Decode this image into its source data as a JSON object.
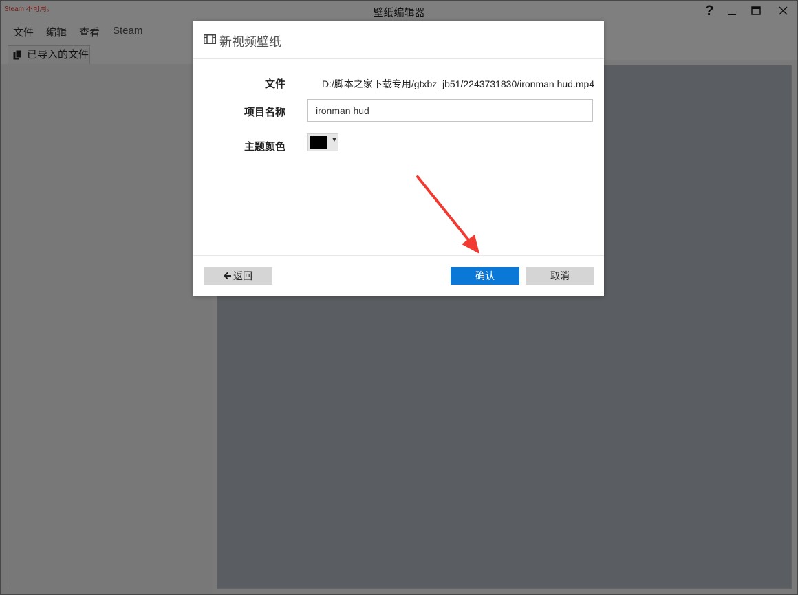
{
  "window": {
    "title": "壁纸编辑器",
    "warning": "Steam 不可用。",
    "help_label": "?",
    "minimize_label": "‒",
    "maximize_label": "□",
    "close_label": "✕"
  },
  "menu": {
    "items": [
      {
        "label": "文件"
      },
      {
        "label": "编辑"
      },
      {
        "label": "查看"
      },
      {
        "label": "Steam"
      }
    ]
  },
  "sidebar": {
    "tab_label": "已导入的文件"
  },
  "dialog": {
    "title": "新视频壁纸",
    "file_label": "文件",
    "file_path": "D:/脚本之家下载专用/gtxbz_jb51/2243731830/ironman hud.mp4",
    "name_label": "项目名称",
    "name_value": "ironman hud",
    "color_label": "主题颜色",
    "color_value": "#000000",
    "back_label": "返回",
    "ok_label": "确认",
    "cancel_label": "取消"
  },
  "colors": {
    "accent": "#0b78d7",
    "annotation": "#f03a32",
    "warning": "#e0443a"
  }
}
